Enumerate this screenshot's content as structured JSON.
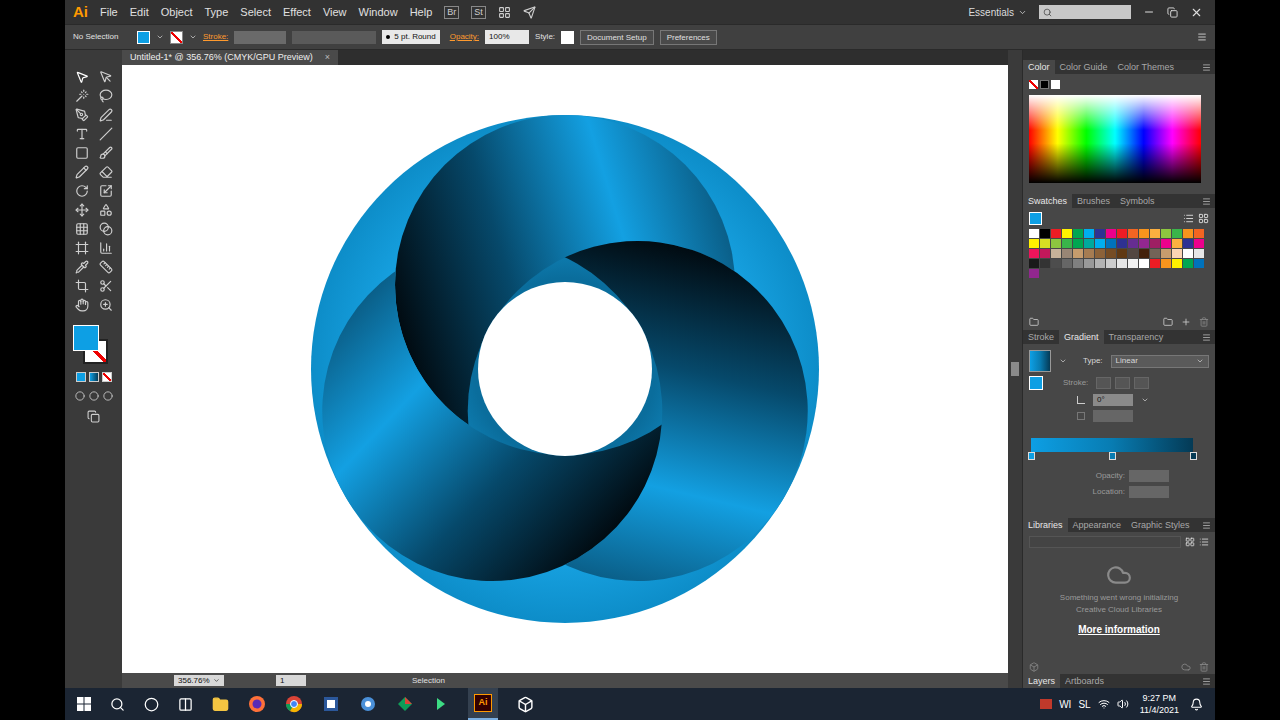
{
  "app": {
    "logo": "Ai",
    "bridge_buttons": [
      "Br",
      "St"
    ],
    "workspace": "Essentials"
  },
  "menu": [
    "File",
    "Edit",
    "Object",
    "Type",
    "Select",
    "Effect",
    "View",
    "Window",
    "Help"
  ],
  "control_bar": {
    "selection": "No Selection",
    "stroke_label": "Stroke:",
    "brush": "5 pt. Round",
    "opacity_label": "Opacity:",
    "opacity": "100%",
    "style_label": "Style:",
    "buttons": [
      "Document Setup",
      "Preferences"
    ]
  },
  "document_tab": {
    "title": "Untitled-1* @ 356.76% (CMYK/GPU Preview)",
    "close": "×"
  },
  "color_panel": {
    "tabs": [
      {
        "label": "Color",
        "selected": true
      },
      {
        "label": "Color Guide",
        "selected": false
      },
      {
        "label": "Color Themes",
        "selected": false
      }
    ]
  },
  "swatches_panel": {
    "tabs": [
      {
        "label": "Swatches",
        "selected": true
      },
      {
        "label": "Brushes",
        "selected": false
      },
      {
        "label": "Symbols",
        "selected": false
      }
    ],
    "swatches": [
      {
        "color": "#ffffff"
      },
      {
        "color": "#000000"
      },
      {
        "color": "#ed1c24"
      },
      {
        "color": "#fff200"
      },
      {
        "color": "#00a651"
      },
      {
        "color": "#00aeef"
      },
      {
        "color": "#2e3192"
      },
      {
        "color": "#ec008c"
      },
      {
        "color": "#ed1c24"
      },
      {
        "color": "#f26522"
      },
      {
        "color": "#f7941d"
      },
      {
        "color": "#fbb040"
      },
      {
        "color": "#8dc63f"
      },
      {
        "color": "#39b54a"
      },
      {
        "color": "#f7941d"
      },
      {
        "color": "#f26522"
      },
      {
        "color": "#fff200"
      },
      {
        "color": "#d7df23"
      },
      {
        "color": "#8dc63f"
      },
      {
        "color": "#39b54a"
      },
      {
        "color": "#00a651"
      },
      {
        "color": "#00a99d"
      },
      {
        "color": "#00aeef"
      },
      {
        "color": "#0072bc"
      },
      {
        "color": "#2e3192"
      },
      {
        "color": "#662d91"
      },
      {
        "color": "#92278f"
      },
      {
        "color": "#9e1f63"
      },
      {
        "color": "#ec008c"
      },
      {
        "color": "#fbb040"
      },
      {
        "color": "#2e3192"
      },
      {
        "color": "#ec008c"
      },
      {
        "color": "#ed145b"
      },
      {
        "color": "#c2185b"
      },
      {
        "color": "#c7b299"
      },
      {
        "color": "#998675"
      },
      {
        "color": "#c69c6d"
      },
      {
        "color": "#a67c52"
      },
      {
        "color": "#8c6239"
      },
      {
        "color": "#754c24"
      },
      {
        "color": "#603913"
      },
      {
        "color": "#534741"
      },
      {
        "color": "#42210b"
      },
      {
        "color": "#736357"
      },
      {
        "color": "#c69c6d"
      },
      {
        "color": "#fcd5b5"
      },
      {
        "color": "#ffffff"
      },
      {
        "color": "#e6e6e6"
      },
      {
        "color": "#1a1a1a"
      },
      {
        "color": "#333333"
      },
      {
        "color": "#4d4d4d"
      },
      {
        "color": "#666666"
      },
      {
        "color": "#808080"
      },
      {
        "color": "#999999"
      },
      {
        "color": "#b3b3b3"
      },
      {
        "color": "#cccccc"
      },
      {
        "color": "#e6e6e6"
      },
      {
        "color": "#f2f2f2"
      },
      {
        "color": "#ffffff"
      },
      {
        "color": "#ed1c24"
      },
      {
        "color": "#f7941d"
      },
      {
        "color": "#fff200"
      },
      {
        "color": "#00a651"
      },
      {
        "color": "#0072bc"
      },
      {
        "color": "#92278f"
      }
    ]
  },
  "gradient_panel": {
    "tabs": [
      {
        "label": "Stroke",
        "selected": false
      },
      {
        "label": "Gradient",
        "selected": true
      },
      {
        "label": "Transparency",
        "selected": false
      }
    ],
    "type_label": "Type:",
    "type": "Linear",
    "stroke_label": "Stroke:",
    "angle": "0°",
    "stops": [
      {
        "color": "#0d9fe4",
        "location": 0
      },
      {
        "color": "#087cb2",
        "location": 0.5
      },
      {
        "color": "#043a55",
        "location": 1
      }
    ],
    "opacity_label": "Opacity:",
    "location_label": "Location:"
  },
  "libraries_panel": {
    "tabs": [
      {
        "label": "Libraries",
        "selected": true
      },
      {
        "label": "Appearance",
        "selected": false
      },
      {
        "label": "Graphic Styles",
        "selected": false
      }
    ],
    "message": "Something went wrong initializing Creative Cloud Libraries",
    "link": "More information"
  },
  "layers_panel": {
    "tabs": [
      {
        "label": "Layers",
        "selected": true
      },
      {
        "label": "Artboards",
        "selected": false
      }
    ]
  },
  "status_bar": {
    "zoom": "356.76%",
    "artboard": "1",
    "tool": "Selection"
  },
  "taskbar": {
    "tray": [
      "WI",
      "SL"
    ],
    "time": "9:27 PM",
    "date": "11/4/2021"
  }
}
